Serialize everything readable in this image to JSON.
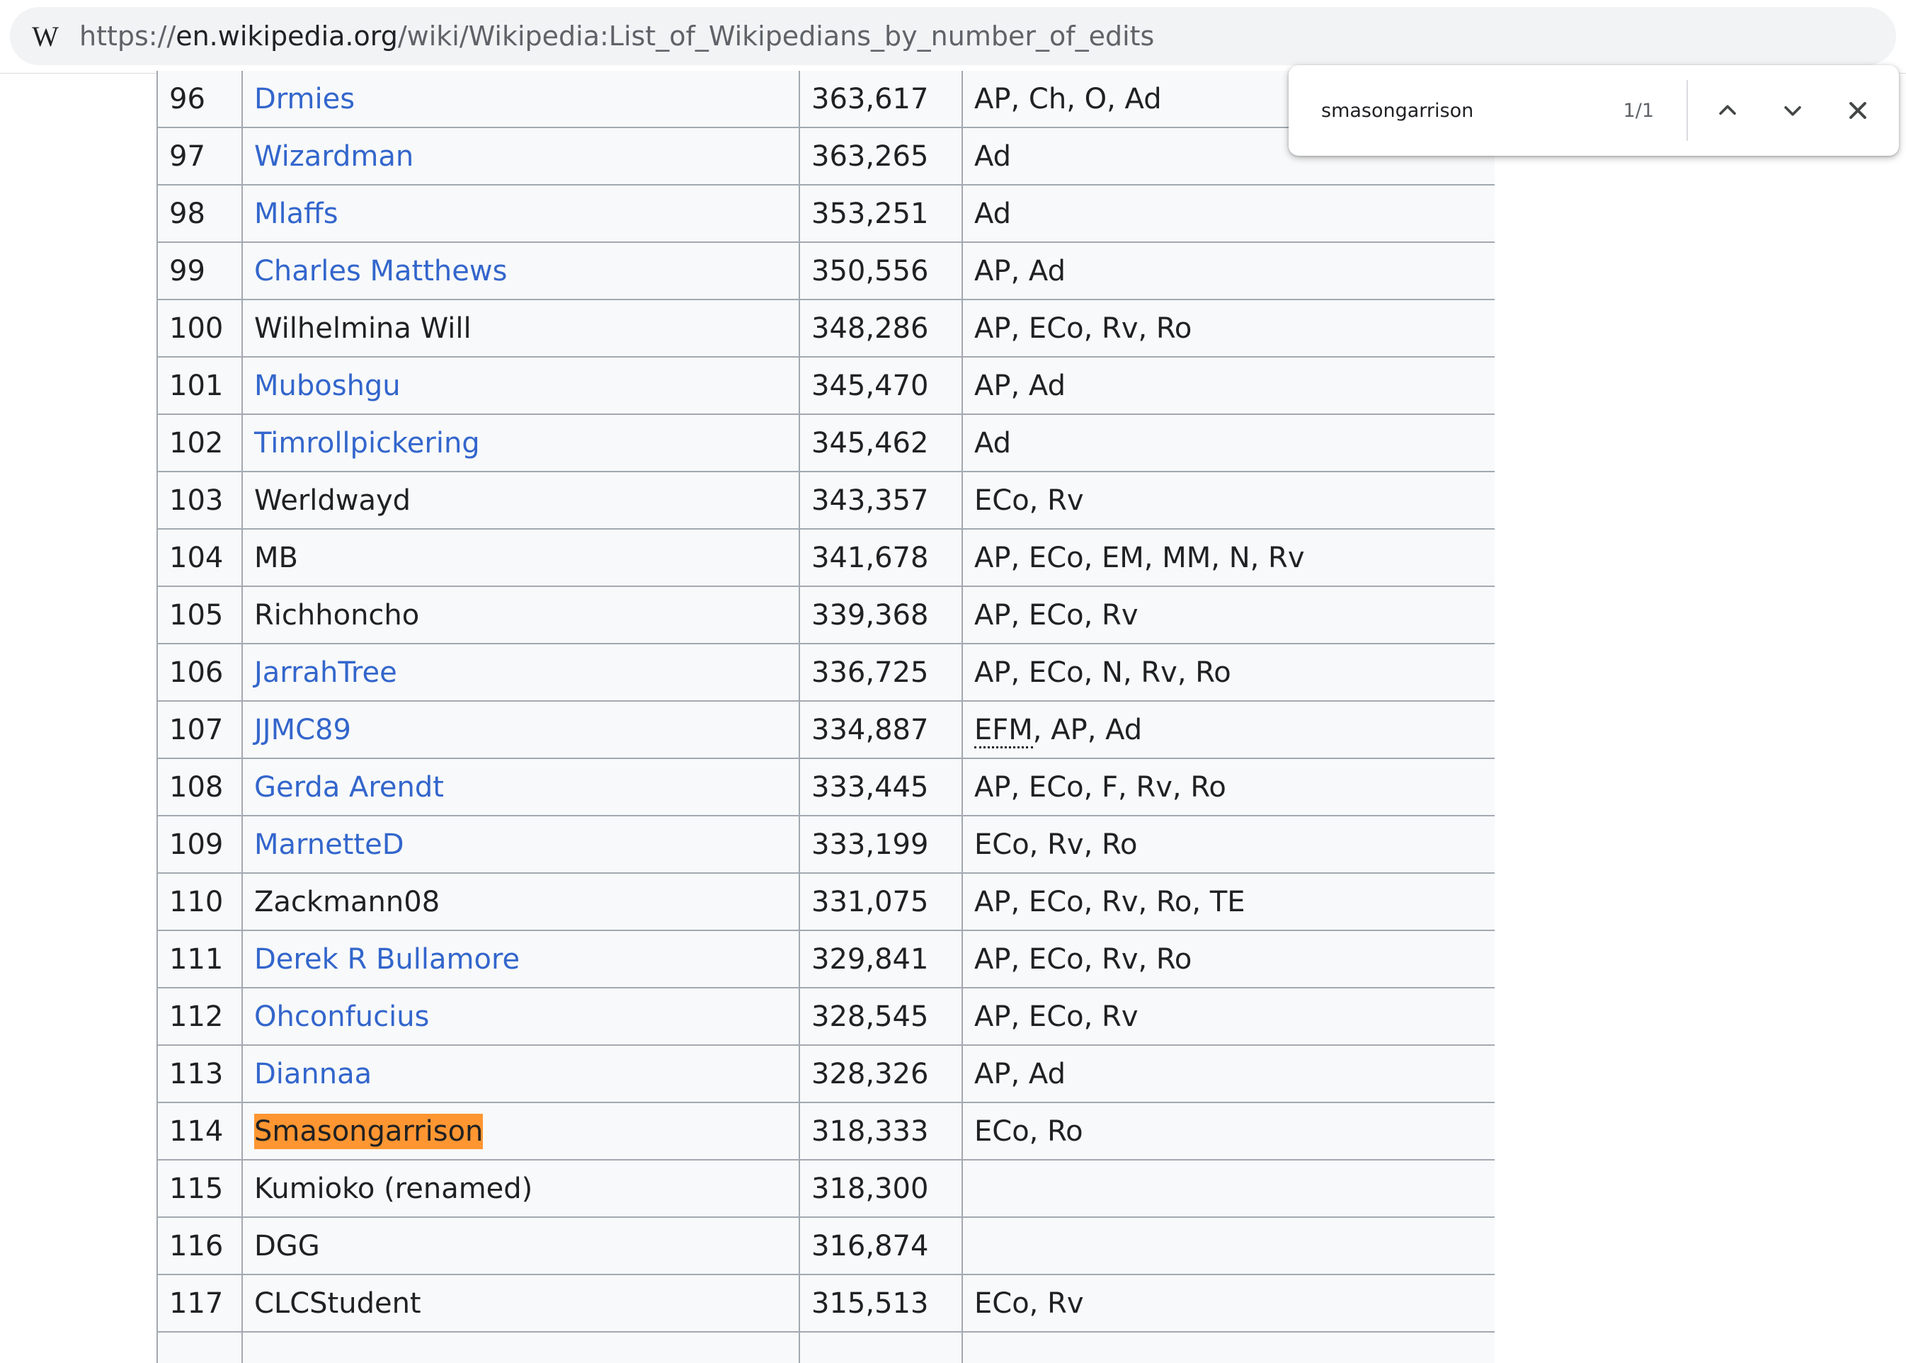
{
  "browser": {
    "favicon_letter": "W",
    "url_scheme": "https://",
    "url_host": "en.wikipedia.org",
    "url_path": "/wiki/Wikipedia:List_of_Wikipedians_by_number_of_edits"
  },
  "find_bar": {
    "query": "smasongarrison",
    "count": "1/1",
    "prev_icon": "chevron-up-icon",
    "next_icon": "chevron-down-icon",
    "close_icon": "close-icon"
  },
  "colors": {
    "link": "#3366cc",
    "highlight": "#ff9632",
    "table_bg": "#f8f9fa",
    "border": "#a2a9b1"
  },
  "table": {
    "rows": [
      {
        "rank": "96",
        "user": "Drmies",
        "link": true,
        "edits": "363,617",
        "groups": "AP, Ch, O, Ad"
      },
      {
        "rank": "97",
        "user": "Wizardman",
        "link": true,
        "edits": "363,265",
        "groups": "Ad"
      },
      {
        "rank": "98",
        "user": "Mlaffs",
        "link": true,
        "edits": "353,251",
        "groups": "Ad"
      },
      {
        "rank": "99",
        "user": "Charles Matthews",
        "link": true,
        "edits": "350,556",
        "groups": "AP, Ad"
      },
      {
        "rank": "100",
        "user": "Wilhelmina Will",
        "link": false,
        "edits": "348,286",
        "groups": "AP, ECo, Rv, Ro"
      },
      {
        "rank": "101",
        "user": "Muboshgu",
        "link": true,
        "edits": "345,470",
        "groups": "AP, Ad"
      },
      {
        "rank": "102",
        "user": "Timrollpickering",
        "link": true,
        "edits": "345,462",
        "groups": "Ad"
      },
      {
        "rank": "103",
        "user": "Werldwayd",
        "link": false,
        "edits": "343,357",
        "groups": "ECo, Rv"
      },
      {
        "rank": "104",
        "user": "MB",
        "link": false,
        "edits": "341,678",
        "groups": "AP, ECo, EM, MM, N, Rv"
      },
      {
        "rank": "105",
        "user": "Richhoncho",
        "link": false,
        "edits": "339,368",
        "groups": "AP, ECo, Rv"
      },
      {
        "rank": "106",
        "user": "JarrahTree",
        "link": true,
        "edits": "336,725",
        "groups": "AP, ECo, N, Rv, Ro"
      },
      {
        "rank": "107",
        "user": "JJMC89",
        "link": true,
        "edits": "334,887",
        "groups_abbr": "EFM",
        "groups": ", AP, Ad"
      },
      {
        "rank": "108",
        "user": "Gerda Arendt",
        "link": true,
        "edits": "333,445",
        "groups": "AP, ECo, F, Rv, Ro"
      },
      {
        "rank": "109",
        "user": "MarnetteD",
        "link": true,
        "edits": "333,199",
        "groups": "ECo, Rv, Ro"
      },
      {
        "rank": "110",
        "user": "Zackmann08",
        "link": false,
        "edits": "331,075",
        "groups": "AP, ECo, Rv, Ro, TE"
      },
      {
        "rank": "111",
        "user": "Derek R Bullamore",
        "link": true,
        "edits": "329,841",
        "groups": "AP, ECo, Rv, Ro"
      },
      {
        "rank": "112",
        "user": "Ohconfucius",
        "link": true,
        "edits": "328,545",
        "groups": "AP, ECo, Rv"
      },
      {
        "rank": "113",
        "user": "Diannaa",
        "link": true,
        "edits": "328,326",
        "groups": "AP, Ad"
      },
      {
        "rank": "114",
        "user": "Smasongarrison",
        "link": false,
        "highlight": true,
        "edits": "318,333",
        "groups": "ECo, Ro"
      },
      {
        "rank": "115",
        "user": "Kumioko (renamed)",
        "link": false,
        "edits": "318,300",
        "groups": ""
      },
      {
        "rank": "116",
        "user": "DGG",
        "link": false,
        "edits": "316,874",
        "groups": ""
      },
      {
        "rank": "117",
        "user": "CLCStudent",
        "link": false,
        "edits": "315,513",
        "groups": "ECo, Rv"
      },
      {
        "rank": "",
        "user": "",
        "link": false,
        "edits": "",
        "groups": ""
      }
    ]
  }
}
